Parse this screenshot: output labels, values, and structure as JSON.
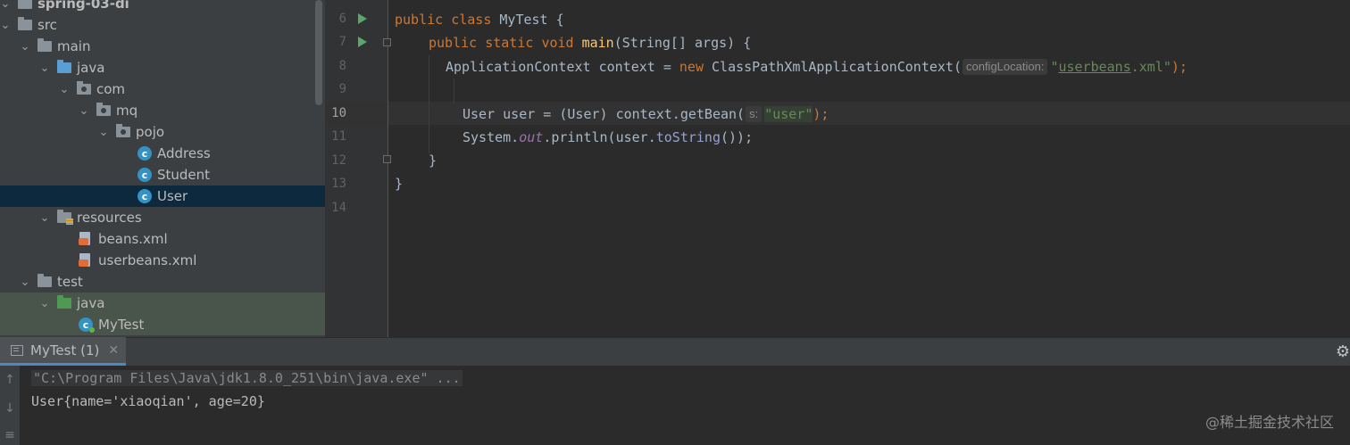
{
  "project_tree": {
    "items": [
      {
        "label": "spring-03-di",
        "kind": "module"
      },
      {
        "label": "src",
        "kind": "folder"
      },
      {
        "label": "main",
        "kind": "folder"
      },
      {
        "label": "java",
        "kind": "source-folder"
      },
      {
        "label": "com",
        "kind": "package"
      },
      {
        "label": "mq",
        "kind": "package"
      },
      {
        "label": "pojo",
        "kind": "package"
      },
      {
        "label": "Address",
        "kind": "class"
      },
      {
        "label": "Student",
        "kind": "class"
      },
      {
        "label": "User",
        "kind": "class",
        "selected": true
      },
      {
        "label": "resources",
        "kind": "resources-folder"
      },
      {
        "label": "beans.xml",
        "kind": "xml"
      },
      {
        "label": "userbeans.xml",
        "kind": "xml"
      },
      {
        "label": "test",
        "kind": "folder"
      },
      {
        "label": "java",
        "kind": "test-source-folder"
      },
      {
        "label": "MyTest",
        "kind": "test-class"
      }
    ]
  },
  "editor": {
    "line_numbers": [
      "6",
      "7",
      "8",
      "9",
      "10",
      "11",
      "12",
      "13",
      "14"
    ],
    "current_line": "10",
    "code": {
      "l6": {
        "kw1": "public",
        "kw2": "class",
        "name": "MyTest",
        "rest": " {"
      },
      "l7": {
        "kw1": "public",
        "kw2": "static",
        "kw3": "void",
        "fn": "main",
        "rest": "(String[] args) {"
      },
      "l8": {
        "pre": "ApplicationContext context = ",
        "kw": "new",
        "mid": " ClassPathXmlApplicationContext(",
        "hint": "configLocation:",
        "str_q1": "\"",
        "str_body": "userbeans",
        "str_rest": ".xml\"",
        "end": ");"
      },
      "l10": {
        "pre": "User user = (User) context.getBean(",
        "hint": "s:",
        "str": "\"user\"",
        "end": ");"
      },
      "l11": {
        "pre": "System.",
        "field": "out",
        "mid": ".println(user.",
        "method": "toString",
        "end": "());"
      },
      "l12": {
        "text": "}"
      },
      "l13": {
        "text": "}"
      }
    }
  },
  "run_panel": {
    "tab_label": "MyTest (1)",
    "close_glyph": "✕",
    "settings_glyph": "⚙",
    "console_lines": {
      "cmd": "\"C:\\Program Files\\Java\\jdk1.8.0_251\\bin\\java.exe\" ...",
      "out": "User{name='xiaoqian', age=20}"
    },
    "side_glyphs": {
      "up": "↑",
      "down": "↓"
    }
  },
  "watermark": "@稀土掘金技术社区"
}
